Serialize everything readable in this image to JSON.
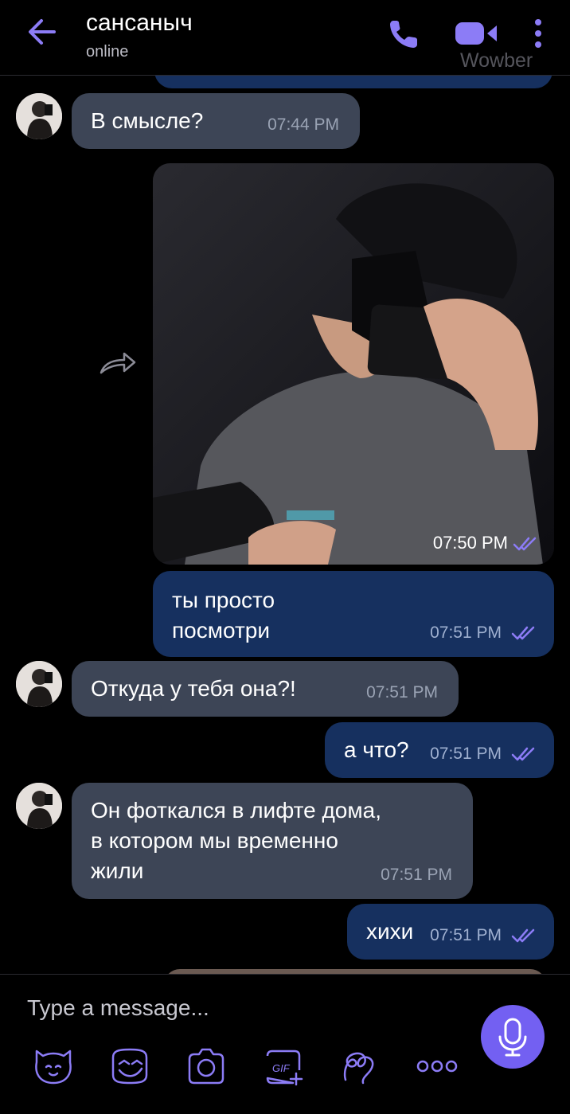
{
  "header": {
    "contact_name": "сансаныч",
    "status": "online",
    "watermark": "Wowber"
  },
  "messages": [
    {
      "direction": "incoming",
      "text": "В смысле?",
      "time": "07:44 PM"
    },
    {
      "direction": "outgoing",
      "type": "photo",
      "time": "07:50 PM",
      "status": "read"
    },
    {
      "direction": "outgoing",
      "text": "ты просто\nпосмотри",
      "time": "07:51 PM",
      "status": "read"
    },
    {
      "direction": "incoming",
      "text": "Откуда у тебя она?!",
      "time": "07:51 PM"
    },
    {
      "direction": "outgoing",
      "text": "а что?",
      "time": "07:51 PM",
      "status": "read"
    },
    {
      "direction": "incoming",
      "text": "Он фоткался в лифте дома,\nв котором мы временно\nжили",
      "time": "07:51 PM"
    },
    {
      "direction": "outgoing",
      "text": "хихи",
      "time": "07:51 PM",
      "status": "read"
    }
  ],
  "composer": {
    "placeholder": "Type a message...",
    "tools": [
      "sticker-icon",
      "emoji-icon",
      "camera-icon",
      "gif-icon",
      "doodle-icon",
      "more-options-icon"
    ],
    "gif_label": "GIF"
  },
  "colors": {
    "accent": "#7360f2",
    "incoming_bubble": "#3d4556",
    "outgoing_bubble": "#16305f",
    "background": "#000000"
  }
}
